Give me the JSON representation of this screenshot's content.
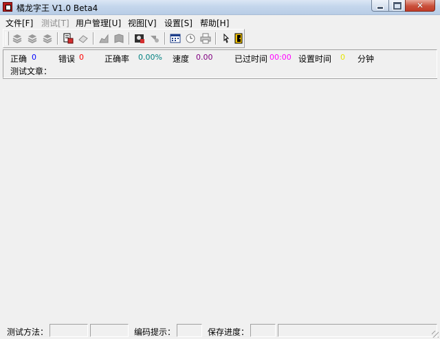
{
  "window": {
    "title": "橘龙字王 V1.0 Beta4",
    "close_symbol": "✕"
  },
  "menu": [
    {
      "label": "文件[F]",
      "enabled": true
    },
    {
      "label": "测试[T]",
      "enabled": false
    },
    {
      "label": "用户管理[U]",
      "enabled": true
    },
    {
      "label": "视图[V]",
      "enabled": true
    },
    {
      "label": "设置[S]",
      "enabled": true
    },
    {
      "label": "帮助[H]",
      "enabled": true
    }
  ],
  "toolbar": {
    "buttons": [
      {
        "icon": "stack-up-icon",
        "enabled": false
      },
      {
        "icon": "stack-mid-icon",
        "enabled": false
      },
      {
        "icon": "stack-down-icon",
        "enabled": false
      },
      {
        "icon": "document-save-icon",
        "enabled": true
      },
      {
        "icon": "eraser-icon",
        "enabled": false
      },
      {
        "icon": "chart-icon",
        "enabled": false
      },
      {
        "icon": "book-icon",
        "enabled": false
      },
      {
        "icon": "user-card-icon",
        "enabled": true
      },
      {
        "icon": "user-settings-icon",
        "enabled": false
      },
      {
        "icon": "calculator-icon",
        "enabled": true
      },
      {
        "icon": "clock-icon",
        "enabled": true
      },
      {
        "icon": "printer-icon",
        "enabled": true
      },
      {
        "icon": "pointer-icon",
        "enabled": true
      },
      {
        "icon": "exit-door-icon",
        "enabled": true
      }
    ]
  },
  "stats": {
    "correct_label": "正确",
    "correct_value": "0",
    "error_label": "错误",
    "error_value": "0",
    "accuracy_label": "正确率",
    "accuracy_value": "0.00%",
    "speed_label": "速度",
    "speed_value": "0.00",
    "elapsed_label": "已过时间",
    "elapsed_value": "00:00",
    "set_time_label": "设置时间",
    "set_time_value": "0",
    "minutes_label": "分钟",
    "article_label": "测试文章："
  },
  "statusbar": {
    "method_label": "测试方法：",
    "method_value": "",
    "method_value2": "",
    "code_hint_label": "编码提示：",
    "code_hint_value": "",
    "save_progress_label": "保存进度：",
    "save_progress_value": "",
    "extra_value": ""
  },
  "colors": {
    "correct": "#0000ff",
    "error": "#ff0000",
    "accuracy": "#008080",
    "speed": "#800080",
    "elapsed": "#ff00ff",
    "set_time": "#e6e600"
  }
}
